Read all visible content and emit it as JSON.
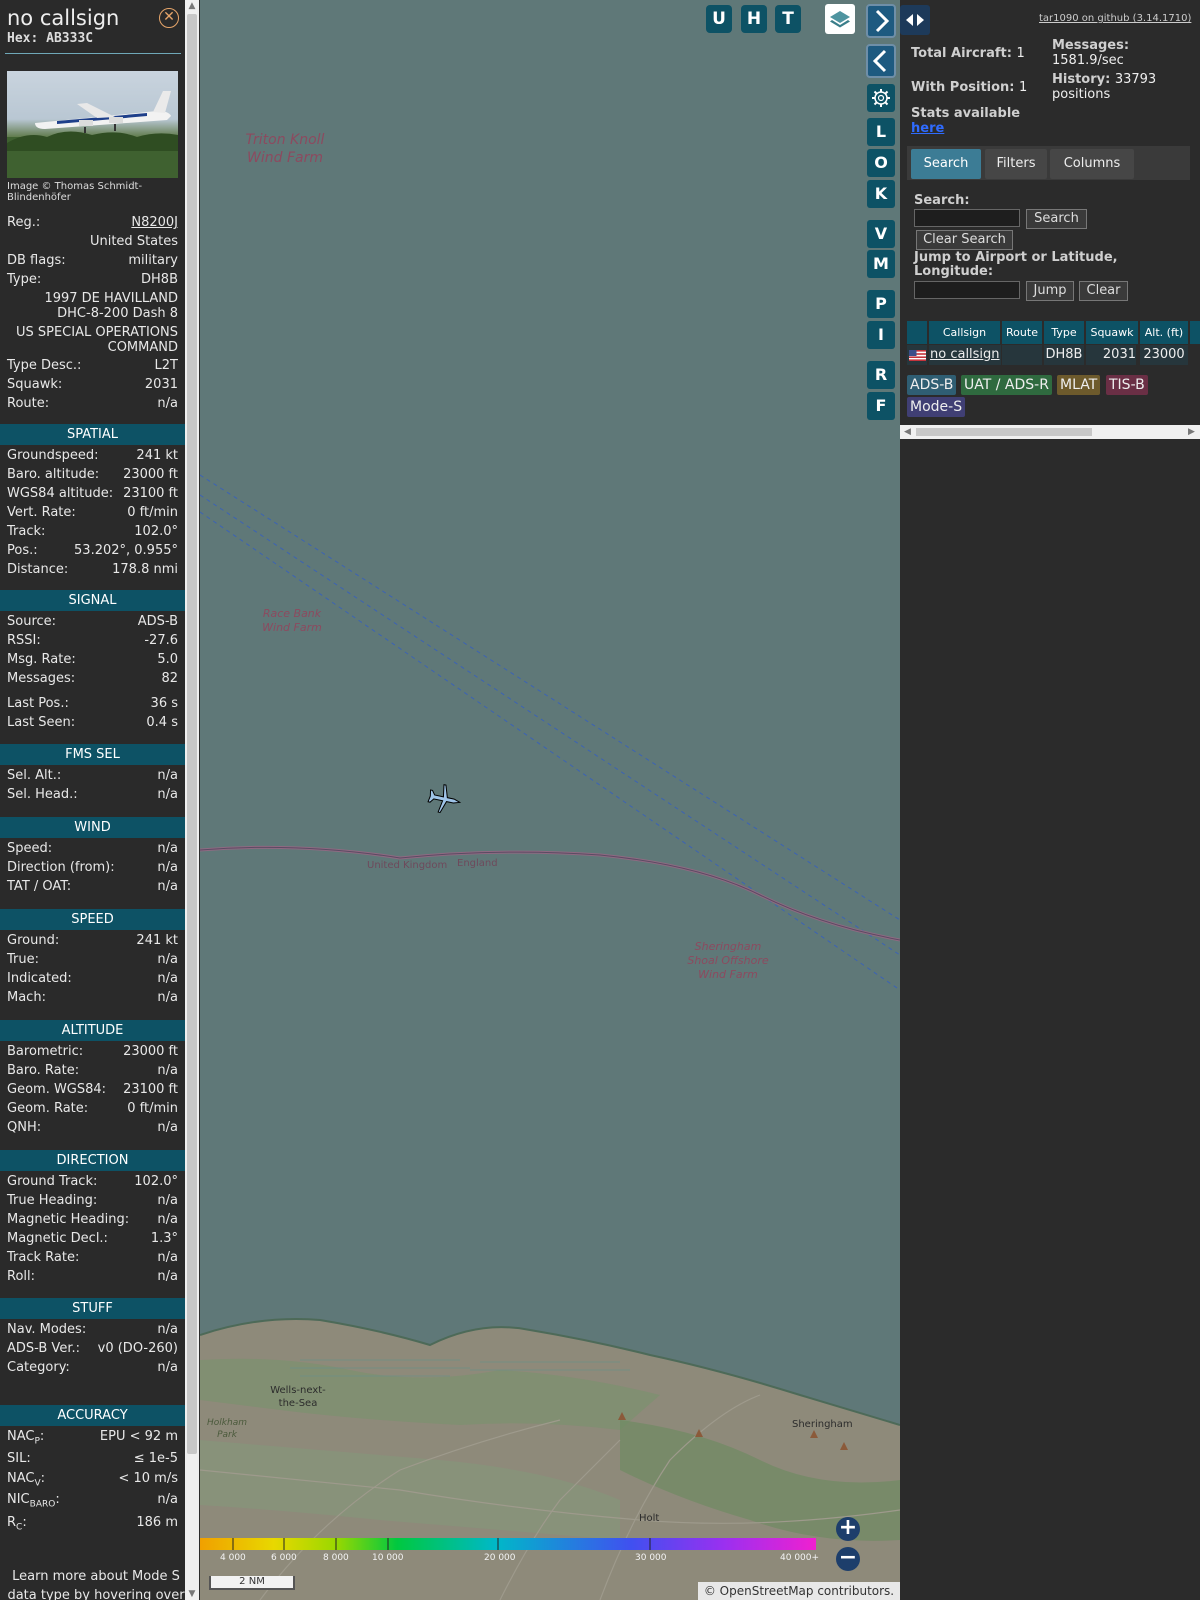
{
  "info": {
    "callsign": "no callsign",
    "hex": "Hex: AB333C",
    "close_icon": "close-icon",
    "photo_credit": "Image © Thomas Schmidt-Blindenhöfer",
    "reg_label": "Reg.:",
    "reg_value": "N8200J",
    "country": "United States",
    "db_flags_label": "DB flags:",
    "db_flags_value": "military",
    "type_label": "Type:",
    "type_value": "DH8B",
    "type_desc_line1": "1997 DE HAVILLAND",
    "type_desc_line2": "DHC-8-200 Dash 8",
    "operator_line1": "US SPECIAL OPERATIONS",
    "operator_line2": "COMMAND",
    "type_desc_label": "Type Desc.:",
    "type_desc_value": "L2T",
    "squawk_label": "Squawk:",
    "squawk_value": "2031",
    "route_label": "Route:",
    "route_value": "n/a",
    "learn_line1": "Learn more about Mode S",
    "learn_line2": "data type by hovering over"
  },
  "sections": {
    "spatial": {
      "title": "SPATIAL",
      "rows": [
        {
          "k": "Groundspeed:",
          "v": "241 kt"
        },
        {
          "k": "Baro. altitude:",
          "v": "23000 ft"
        },
        {
          "k": "WGS84 altitude:",
          "v": "23100 ft"
        },
        {
          "k": "Vert. Rate:",
          "v": "0 ft/min"
        },
        {
          "k": "Track:",
          "v": "102.0°"
        },
        {
          "k": "Pos.:",
          "v": "53.202°, 0.955°"
        },
        {
          "k": "Distance:",
          "v": "178.8 nmi"
        }
      ]
    },
    "signal": {
      "title": "SIGNAL",
      "rows": [
        {
          "k": "Source:",
          "v": "ADS-B"
        },
        {
          "k": "RSSI:",
          "v": "-27.6"
        },
        {
          "k": "Msg. Rate:",
          "v": "5.0"
        },
        {
          "k": "Messages:",
          "v": "82"
        },
        {
          "k": "Last Pos.:",
          "v": "36 s"
        },
        {
          "k": "Last Seen:",
          "v": "0.4 s"
        }
      ]
    },
    "fms": {
      "title": "FMS SEL",
      "rows": [
        {
          "k": "Sel. Alt.:",
          "v": "n/a"
        },
        {
          "k": "Sel. Head.:",
          "v": "n/a"
        }
      ]
    },
    "wind": {
      "title": "WIND",
      "rows": [
        {
          "k": "Speed:",
          "v": "n/a"
        },
        {
          "k": "Direction (from):",
          "v": "n/a"
        },
        {
          "k": "TAT / OAT:",
          "v": "n/a"
        }
      ]
    },
    "speed": {
      "title": "SPEED",
      "rows": [
        {
          "k": "Ground:",
          "v": "241 kt"
        },
        {
          "k": "True:",
          "v": "n/a"
        },
        {
          "k": "Indicated:",
          "v": "n/a"
        },
        {
          "k": "Mach:",
          "v": "n/a"
        }
      ]
    },
    "altitude": {
      "title": "ALTITUDE",
      "rows": [
        {
          "k": "Barometric:",
          "v": "23000 ft"
        },
        {
          "k": "Baro. Rate:",
          "v": "n/a"
        },
        {
          "k": "Geom. WGS84:",
          "v": "23100 ft"
        },
        {
          "k": "Geom. Rate:",
          "v": "0 ft/min"
        },
        {
          "k": "QNH:",
          "v": "n/a"
        }
      ]
    },
    "direction": {
      "title": "DIRECTION",
      "rows": [
        {
          "k": "Ground Track:",
          "v": "102.0°"
        },
        {
          "k": "True Heading:",
          "v": "n/a"
        },
        {
          "k": "Magnetic Heading:",
          "v": "n/a"
        },
        {
          "k": "Magnetic Decl.:",
          "v": "1.3°"
        },
        {
          "k": "Track Rate:",
          "v": "n/a"
        },
        {
          "k": "Roll:",
          "v": "n/a"
        }
      ]
    },
    "stuff": {
      "title": "STUFF",
      "rows": [
        {
          "k": "Nav. Modes:",
          "v": "n/a"
        },
        {
          "k": "ADS-B Ver.:",
          "v": "v0 (DO-260)"
        },
        {
          "k": "Category:",
          "v": "n/a"
        }
      ]
    },
    "accuracy": {
      "title": "ACCURACY",
      "rows": [
        {
          "k": "NAC",
          "sub": "P",
          "v": "EPU < 92 m"
        },
        {
          "k": "SIL:",
          "sub": "",
          "v": "≤ 1e-5"
        },
        {
          "k": "NAC",
          "sub": "V",
          "v": "< 10 m/s"
        },
        {
          "k": "NIC",
          "sub": "BARO",
          "v": "n/a"
        },
        {
          "k": "R",
          "sub": "C",
          "v": "186 m"
        }
      ]
    }
  },
  "map": {
    "labels": {
      "triton1": "Triton Knoll",
      "triton2": "Wind Farm",
      "race1": "Race Bank",
      "race2": "Wind Farm",
      "uk": "United Kingdom",
      "england": "England",
      "sher1": "Sheringham",
      "sher2": "Shoal Offshore",
      "sher3": "Wind Farm",
      "wells1": "Wells-next-",
      "wells2": "the-Sea",
      "holkham1": "Holkham",
      "holkham2": "Park",
      "sheringham": "Sheringham",
      "holt": "Holt"
    },
    "top_buttons": [
      "U",
      "H",
      "T"
    ],
    "side_buttons": [
      "L",
      "O",
      "K",
      "V",
      "M",
      "P",
      "I",
      "R",
      "F"
    ],
    "layers_icon": "layers-icon",
    "settings_icon": "gear-icon",
    "zoom_in": "+",
    "zoom_out": "−",
    "scale": "2 NM",
    "attribution": "© OpenStreetMap contributors.",
    "altitude_legend": [
      "4 000",
      "6 000",
      "8 000",
      "10 000",
      "20 000",
      "30 000",
      "40 000+"
    ]
  },
  "right": {
    "github": "tar1090 on github (3.14.1710)",
    "total_label": "Total Aircraft:",
    "total_value": "1",
    "pos_label": "With Position:",
    "pos_value": "1",
    "messages_label": "Messages:",
    "messages_value": "1581.9/sec",
    "history_label": "History:",
    "history_value": "33793",
    "history_unit": "positions",
    "stats_label": "Stats available",
    "stats_link": "here",
    "tabs": [
      "Search",
      "Filters",
      "Columns"
    ],
    "search_label": "Search:",
    "search_value": "",
    "search_button": "Search",
    "clear_search_button": "Clear Search",
    "jump_label": "Jump to Airport or Latitude, Longitude:",
    "jump_value": "",
    "jump_button": "Jump",
    "clear_button": "Clear",
    "table": {
      "headers": [
        "Callsign",
        "Route",
        "Type",
        "Squawk",
        "Alt. (ft)"
      ],
      "row": {
        "callsign": "no callsign",
        "route": "",
        "type": "DH8B",
        "squawk": "2031",
        "alt": "23000"
      }
    },
    "legend_chips": [
      {
        "label": "ADS-B",
        "color": "#2f5e73"
      },
      {
        "label": "UAT / ADS-R",
        "color": "#2f6a3f"
      },
      {
        "label": "MLAT",
        "color": "#6d5a2c"
      },
      {
        "label": "TIS-B",
        "color": "#6a2f45"
      },
      {
        "label": "Mode-S",
        "color": "#403f74"
      }
    ]
  }
}
